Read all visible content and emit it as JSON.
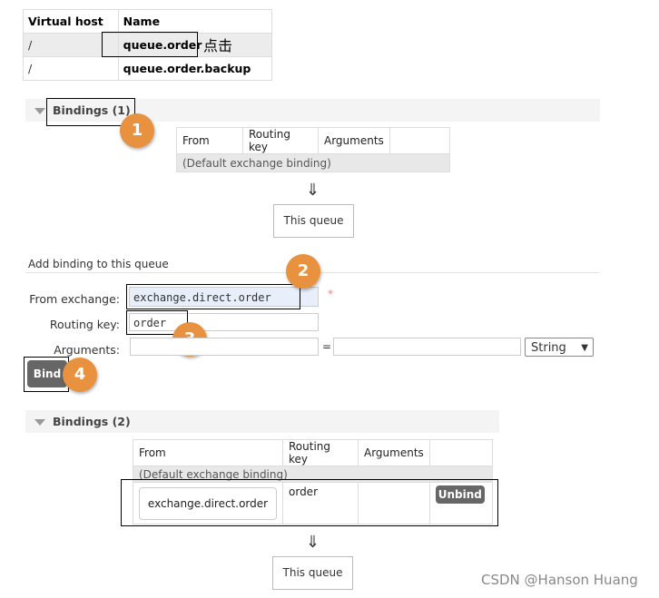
{
  "queues_table": {
    "headers": [
      "Virtual host",
      "Name"
    ],
    "rows": [
      {
        "vhost": "/",
        "name": "queue.order"
      },
      {
        "vhost": "/",
        "name": "queue.order.backup"
      }
    ],
    "annotation": "点击"
  },
  "bindings1": {
    "title": "Bindings (1)",
    "headers": [
      "From",
      "Routing key",
      "Arguments"
    ],
    "default_row": "(Default exchange binding)",
    "arrow": "⇓",
    "this_queue": "This queue"
  },
  "add_binding": {
    "title": "Add binding to this queue",
    "from_label": "From exchange:",
    "from_value": "exchange.direct.order",
    "required": "*",
    "routing_label": "Routing key:",
    "routing_value": "order",
    "args_label": "Arguments:",
    "equals": "=",
    "type_select": "String",
    "bind_label": "Bind"
  },
  "bindings2": {
    "title": "Bindings (2)",
    "headers": [
      "From",
      "Routing key",
      "Arguments"
    ],
    "default_row": "(Default exchange binding)",
    "row": {
      "from": "exchange.direct.order",
      "routing_key": "order",
      "unbind": "Unbind"
    },
    "arrow": "⇓",
    "this_queue": "This queue"
  },
  "badges": [
    "1",
    "2",
    "3",
    "4"
  ],
  "watermark": "CSDN @Hanson Huang",
  "colors": {
    "badge": "#e8923f",
    "button": "#666666",
    "input_highlight": "#e8eefa"
  }
}
